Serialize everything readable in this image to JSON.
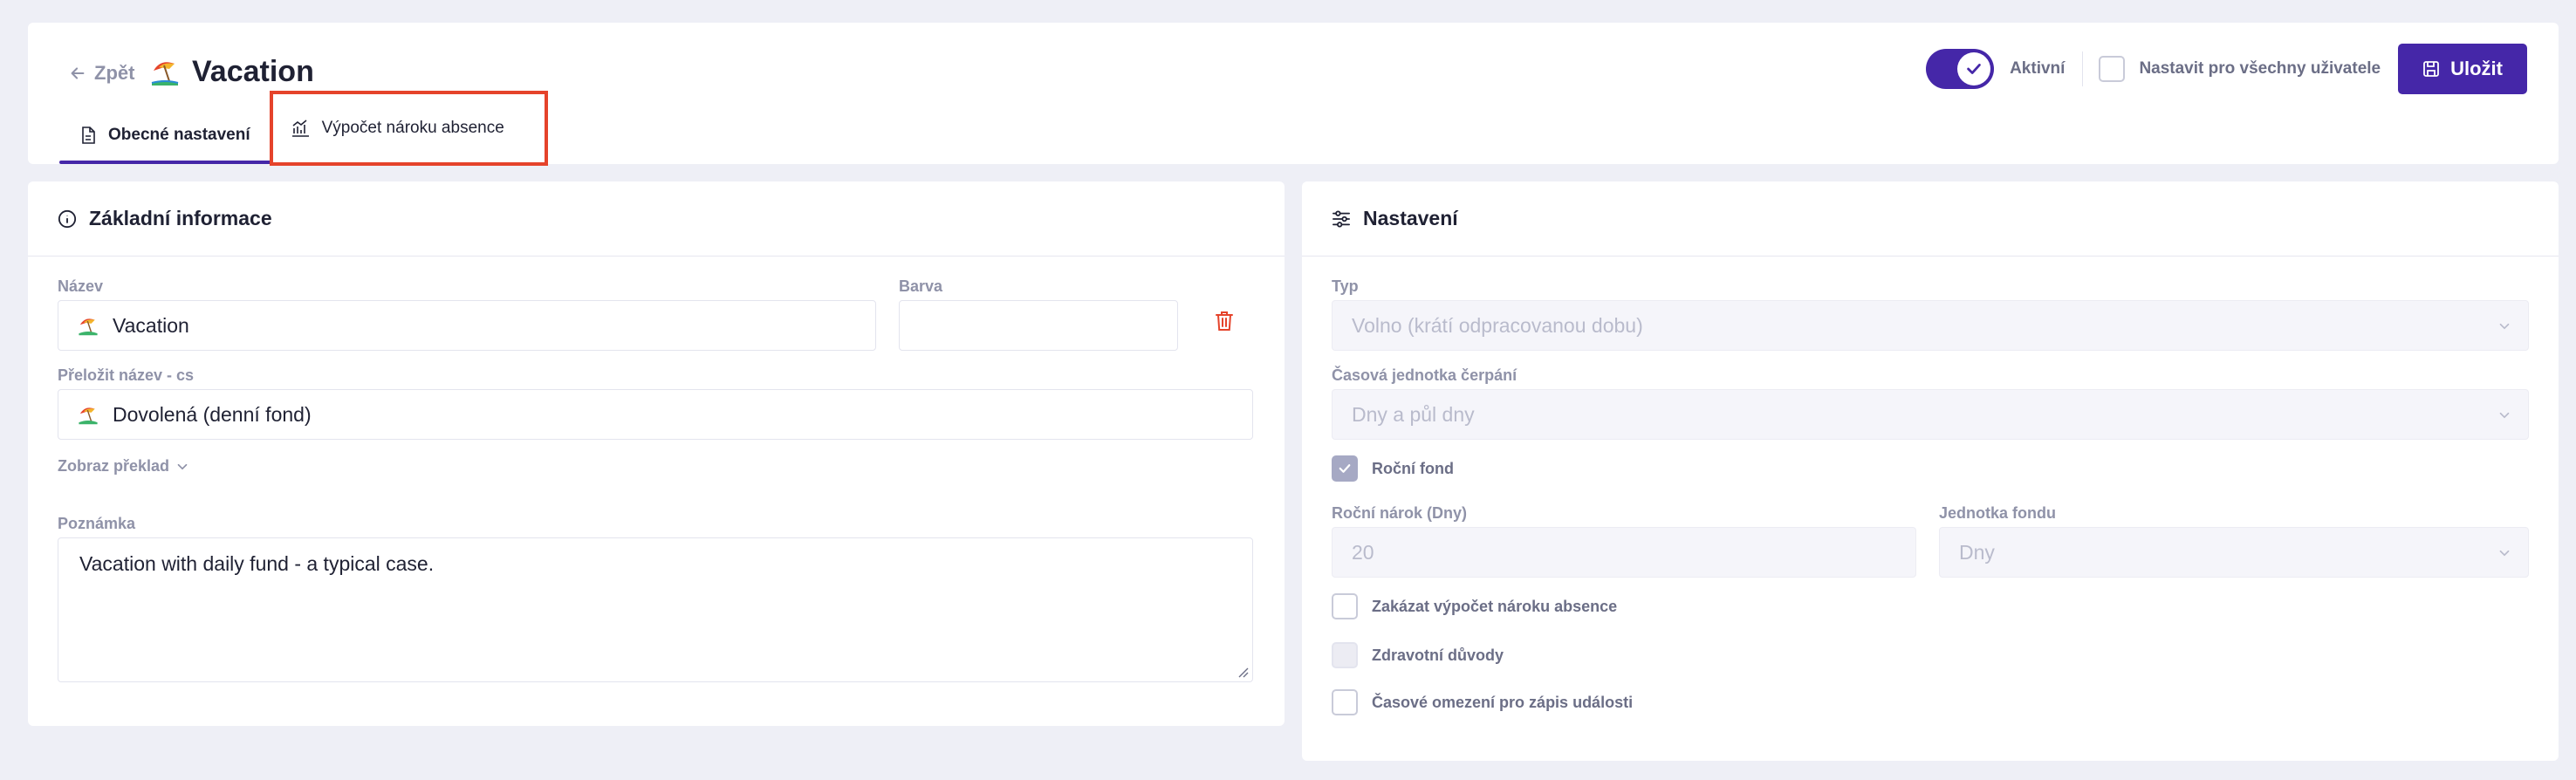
{
  "header": {
    "back_label": "Zpět",
    "title": "Vacation",
    "tabs": [
      {
        "label": "Obecné nastavení",
        "active": true
      },
      {
        "label": "Výpočet nároku absence",
        "active": false
      }
    ],
    "active_toggle_label": "Aktivní",
    "active_toggle_on": true,
    "all_users_label": "Nastavit pro všechny uživatele",
    "all_users_checked": false,
    "save_label": "Uložit"
  },
  "basic_info": {
    "title": "Základní informace",
    "name_label": "Název",
    "name_value": "Vacation",
    "color_label": "Barva",
    "color_value": "",
    "translate_label": "Přeložit název - cs",
    "translate_value": "Dovolená (denní fond)",
    "show_translation_label": "Zobraz překlad",
    "note_label": "Poznámka",
    "note_value": "Vacation with daily fund - a typical case."
  },
  "settings": {
    "title": "Nastavení",
    "type_label": "Typ",
    "type_value": "Volno (krátí odpracovanou dobu)",
    "time_unit_label": "Časová jednotka čerpání",
    "time_unit_value": "Dny a půl dny",
    "annual_fund_label": "Roční fond",
    "annual_fund_checked": true,
    "annual_entitlement_label": "Roční nárok (Dny)",
    "annual_entitlement_value": "20",
    "fund_unit_label": "Jednotka fondu",
    "fund_unit_value": "Dny",
    "disable_calc_label": "Zakázat výpočet nároku absence",
    "health_label": "Zdravotní důvody",
    "time_limit_label": "Časové omezení pro zápis události"
  },
  "colors": {
    "accent": "#4527a8",
    "highlight_border": "#e5432b",
    "delete_icon": "#e5432b",
    "background": "#eeeff6"
  }
}
